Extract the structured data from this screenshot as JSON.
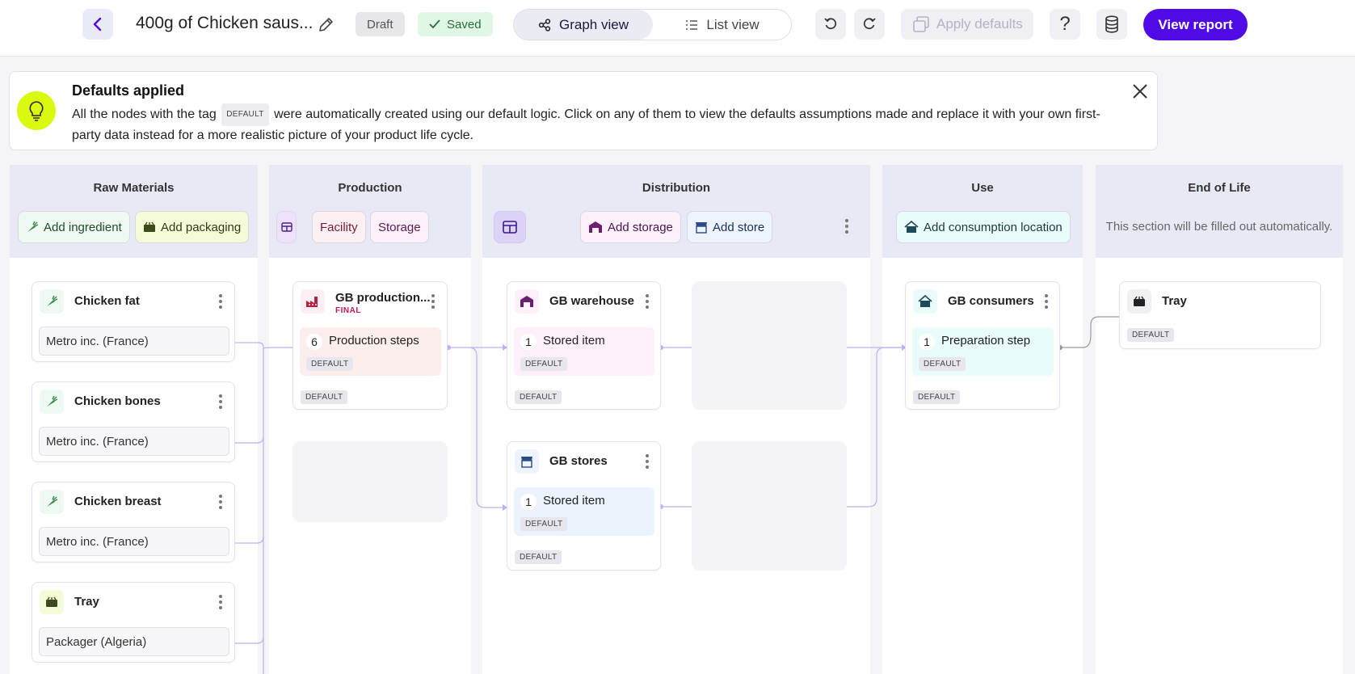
{
  "header": {
    "title": "400g of Chicken saus...",
    "status_draft": "Draft",
    "status_saved": "Saved",
    "view_graph": "Graph view",
    "view_list": "List view",
    "apply_defaults": "Apply defaults",
    "help_glyph": "?",
    "view_report": "View report"
  },
  "banner": {
    "title": "Defaults applied",
    "text_before": "All the nodes with the tag",
    "tag": "DEFAULT",
    "text_after": "were automatically created using our default logic. Click on any of them to view the defaults assumptions made and replace it with your own first-party data instead for a more realistic picture of your product life cycle."
  },
  "columns": {
    "raw": {
      "title": "Raw Materials",
      "add_ingredient": "Add ingredient",
      "add_packaging": "Add packaging"
    },
    "production": {
      "title": "Production",
      "facility": "Facility",
      "storage": "Storage"
    },
    "distribution": {
      "title": "Distribution",
      "add_storage": "Add storage",
      "add_store": "Add store"
    },
    "use": {
      "title": "Use",
      "add_location": "Add consumption location"
    },
    "eol": {
      "title": "End of Life",
      "note": "This section will be filled out automatically."
    }
  },
  "raw_nodes": [
    {
      "name": "Chicken fat",
      "supplier": "Metro inc. (France)"
    },
    {
      "name": "Chicken bones",
      "supplier": "Metro inc. (France)"
    },
    {
      "name": "Chicken breast",
      "supplier": "Metro inc. (France)"
    },
    {
      "name": "Tray",
      "supplier": "Packager (Algeria)"
    }
  ],
  "production_node": {
    "name": "GB production...",
    "badge": "FINAL",
    "step_count": "6",
    "step_label": "Production steps",
    "tag": "DEFAULT"
  },
  "distribution_nodes": [
    {
      "name": "GB warehouse",
      "step_count": "1",
      "step_label": "Stored item",
      "tag": "DEFAULT"
    },
    {
      "name": "GB stores",
      "step_count": "1",
      "step_label": "Stored item",
      "tag": "DEFAULT"
    }
  ],
  "use_node": {
    "name": "GB consumers",
    "step_count": "1",
    "step_label": "Preparation step",
    "tag": "DEFAULT"
  },
  "eol_node": {
    "name": "Tray",
    "tag": "DEFAULT"
  },
  "colors": {
    "accent": "#4f0ae6",
    "edge": "#b9b2f0",
    "production_step": "#fdeeee",
    "warehouse_step": "#fdf0fb",
    "store_step": "#ecf3fd",
    "consumer_step": "#e9fbfb"
  }
}
